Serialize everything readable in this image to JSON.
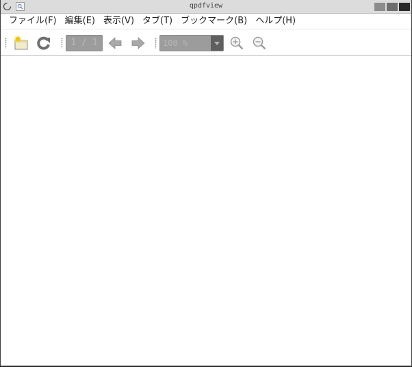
{
  "window": {
    "title": "qpdfview"
  },
  "menu": [
    {
      "label": "ファイル(F)"
    },
    {
      "label": "編集(E)"
    },
    {
      "label": "表示(V)"
    },
    {
      "label": "タブ(T)"
    },
    {
      "label": "ブックマーク(B)"
    },
    {
      "label": "ヘルプ(H)"
    }
  ],
  "toolbar": {
    "page_value": "1 / 1",
    "zoom_value": "100 %"
  },
  "icons": {
    "open": "open-folder-icon",
    "refresh": "refresh-icon",
    "prev": "previous-page-icon",
    "next": "next-page-icon",
    "zoom_in": "zoom-in-icon",
    "zoom_out": "zoom-out-icon"
  }
}
